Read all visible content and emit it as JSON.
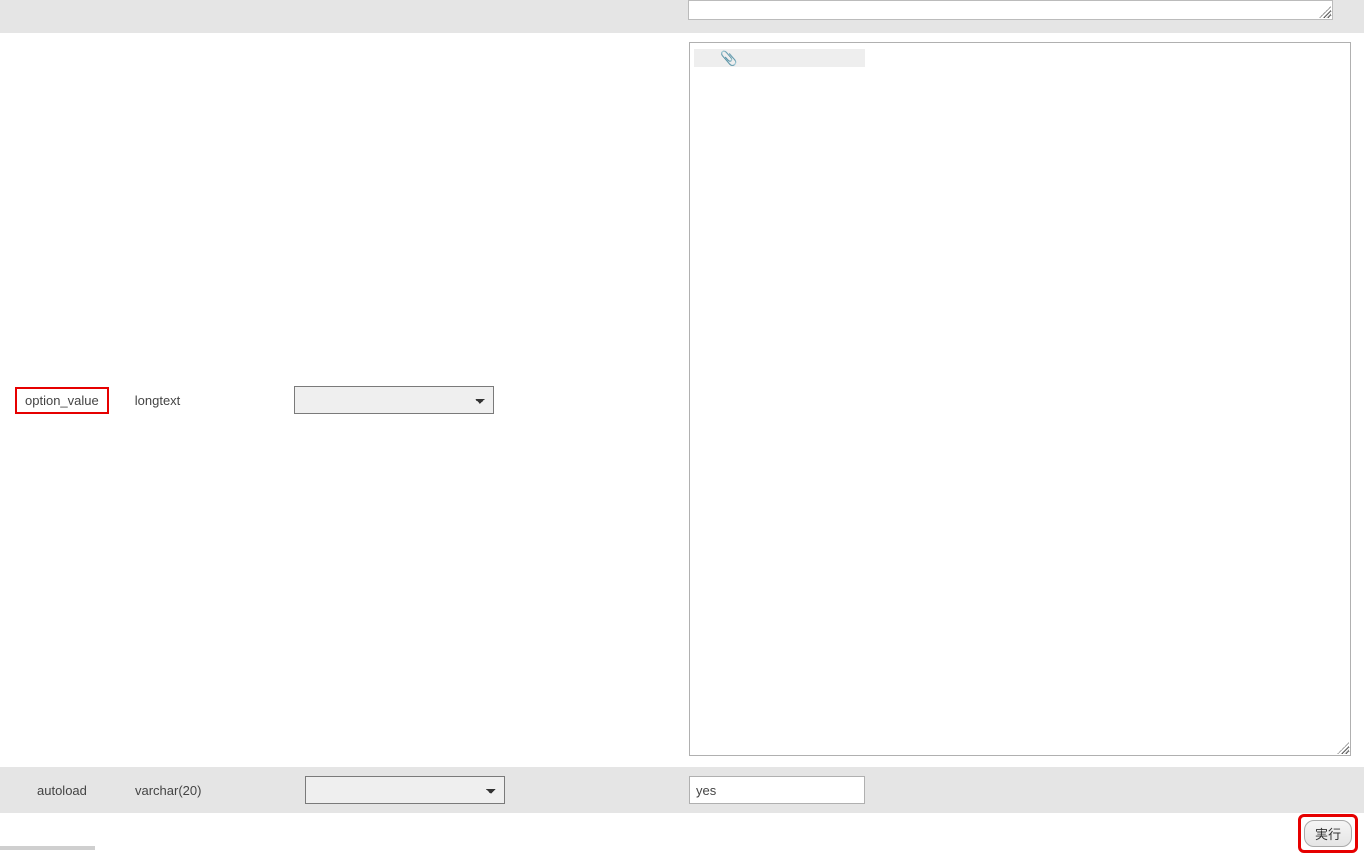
{
  "rows": {
    "option_value": {
      "name": "option_value",
      "type": "longtext",
      "function_selected": "",
      "value": ""
    },
    "autoload": {
      "name": "autoload",
      "type": "varchar(20)",
      "function_selected": "",
      "value": "yes"
    }
  },
  "submit_label": "実行",
  "attach_icon_glyph": "📎"
}
